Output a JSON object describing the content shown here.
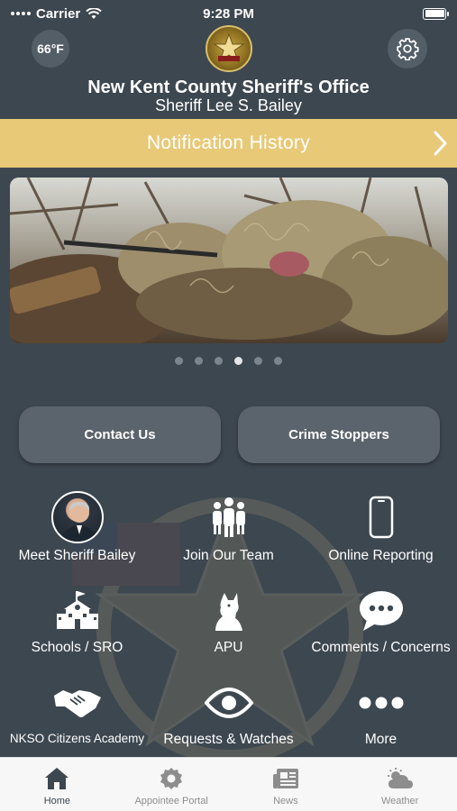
{
  "status_bar": {
    "carrier": "Carrier",
    "time": "9:28 PM"
  },
  "header": {
    "temperature": "66°F",
    "agency_name": "New Kent County Sheriff's Office",
    "sheriff_name": "Sheriff Lee S. Bailey"
  },
  "notification_bar": {
    "label": "Notification History"
  },
  "carousel": {
    "page_count": 6,
    "active_index": 3
  },
  "buttons": {
    "contact": "Contact Us",
    "crime_stoppers": "Crime Stoppers"
  },
  "grid": [
    {
      "label": "Meet Sheriff Bailey",
      "icon": "sheriff-photo"
    },
    {
      "label": "Join Our Team",
      "icon": "people-group-icon"
    },
    {
      "label": "Online Reporting",
      "icon": "phone-icon"
    },
    {
      "label": "Schools / SRO",
      "icon": "school-icon"
    },
    {
      "label": "APU",
      "icon": "dog-icon"
    },
    {
      "label": "Comments / Concerns",
      "icon": "chat-bubble-icon"
    },
    {
      "label": "NKSO Citizens Academy",
      "icon": "handshake-icon"
    },
    {
      "label": "Requests & Watches",
      "icon": "eye-icon"
    },
    {
      "label": "More",
      "icon": "more-icon"
    }
  ],
  "tabs": [
    {
      "label": "Home",
      "icon": "home-icon",
      "active": true
    },
    {
      "label": "Appointee Portal",
      "icon": "gear-badge-icon",
      "active": false
    },
    {
      "label": "News",
      "icon": "newspaper-icon",
      "active": false
    },
    {
      "label": "Weather",
      "icon": "weather-icon",
      "active": false
    }
  ],
  "colors": {
    "background": "#3d4750",
    "notification_bar": "#e8c978",
    "button": "#5b646c",
    "tab_bar": "#f7f7f7"
  }
}
